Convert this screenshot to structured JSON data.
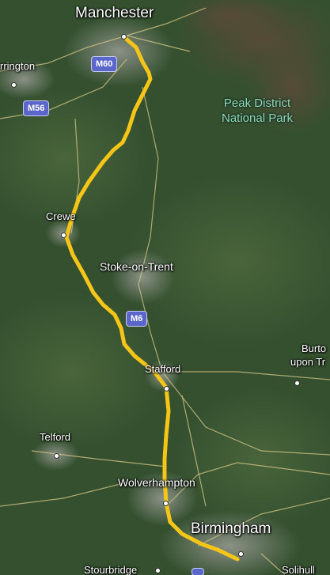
{
  "places": {
    "manchester": "Manchester",
    "warrington": "rrington",
    "crewe": "Crewe",
    "stoke": "Stoke-on-Trent",
    "stafford": "Stafford",
    "telford": "Telford",
    "wolverhampton": "Wolverhampton",
    "birmingham": "Birmingham",
    "stourbridge": "Stourbridge",
    "solihull": "Solihull",
    "burton_line1": "Burto",
    "burton_line2": "upon Tr",
    "park_line1": "Peak District",
    "park_line2": "National Park"
  },
  "roads": {
    "m60": "M60",
    "m56": "M56",
    "m6": "M6"
  },
  "route": {
    "color": "#f5c518",
    "from": "Manchester",
    "to": "Birmingham"
  },
  "colors": {
    "terrain": "#2f4a2c",
    "urban": "#8b8f88",
    "road": "#d8c98a",
    "park_label": "#8fdca6",
    "shield": "#5a66c9"
  }
}
